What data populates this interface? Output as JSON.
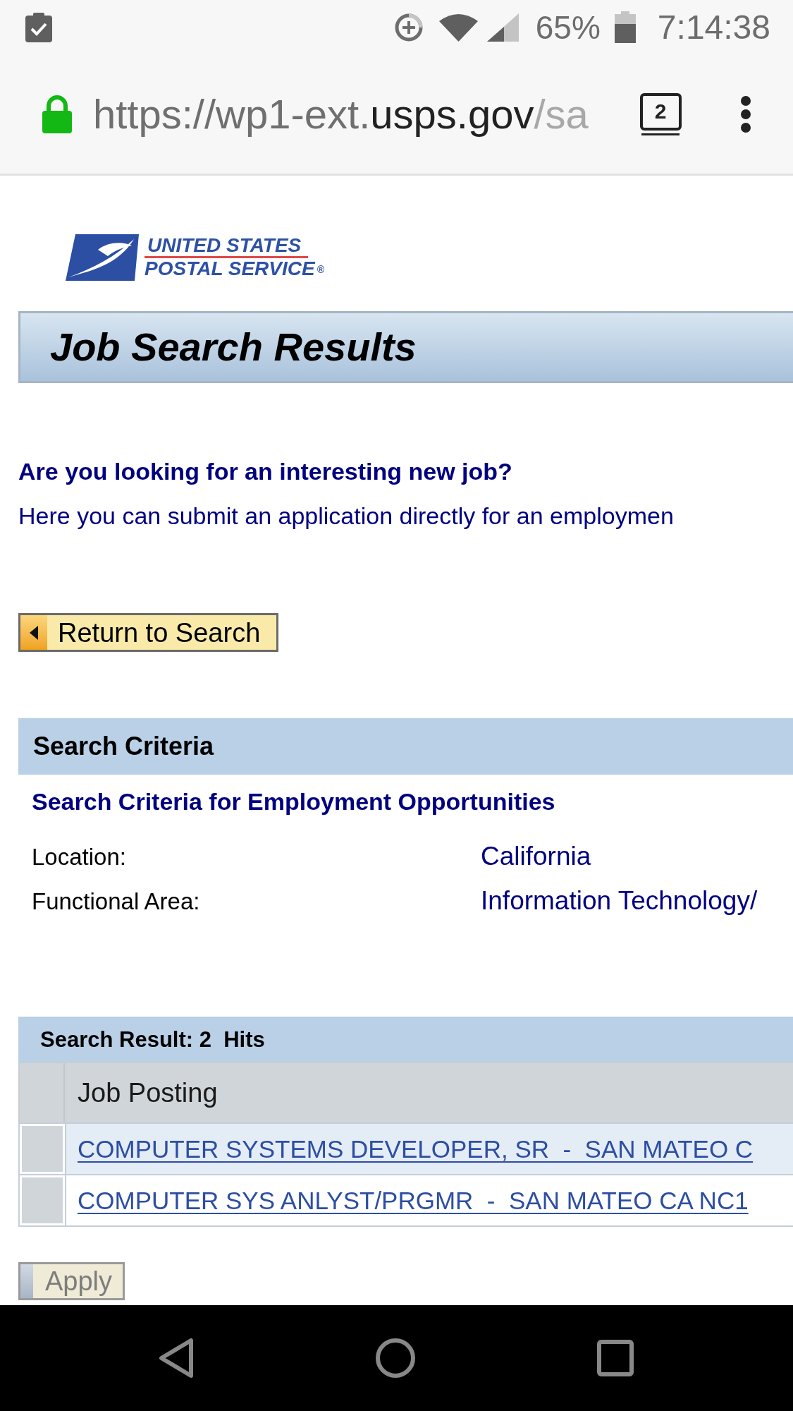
{
  "status_bar": {
    "battery": "65%",
    "time": "7:14:38"
  },
  "browser": {
    "secure": true,
    "url": {
      "host_prefix": "https://wp1-ext.",
      "domain": "usps.gov",
      "path": "/sa"
    },
    "tab_count": "2"
  },
  "logo": {
    "line_1": "UNITED STATES",
    "line_2": "POSTAL SERVICE",
    "mark": "®"
  },
  "page_title": "Job Search Results",
  "intro": {
    "heading": "Are you looking for an interesting new job?",
    "text": "Here you can submit an application directly for an employmen"
  },
  "return_button": {
    "label": "Return to Search"
  },
  "search_criteria": {
    "title": "Search Criteria",
    "subtitle": "Search Criteria for Employment Opportunities",
    "fields": [
      {
        "label": "Location:",
        "value": "California"
      },
      {
        "label": "Functional Area:",
        "value": "Information Technology/"
      }
    ]
  },
  "search_result": {
    "title": "Search Result: 2  Hits",
    "columns": [
      "Job Posting"
    ],
    "rows": [
      {
        "job_posting": "COMPUTER SYSTEMS DEVELOPER, SR  -  SAN MATEO C"
      },
      {
        "job_posting": "COMPUTER SYS ANLYST/PRGMR  -  SAN MATEO CA NC1"
      }
    ]
  },
  "apply_button": {
    "label": "Apply",
    "disabled": true
  }
}
